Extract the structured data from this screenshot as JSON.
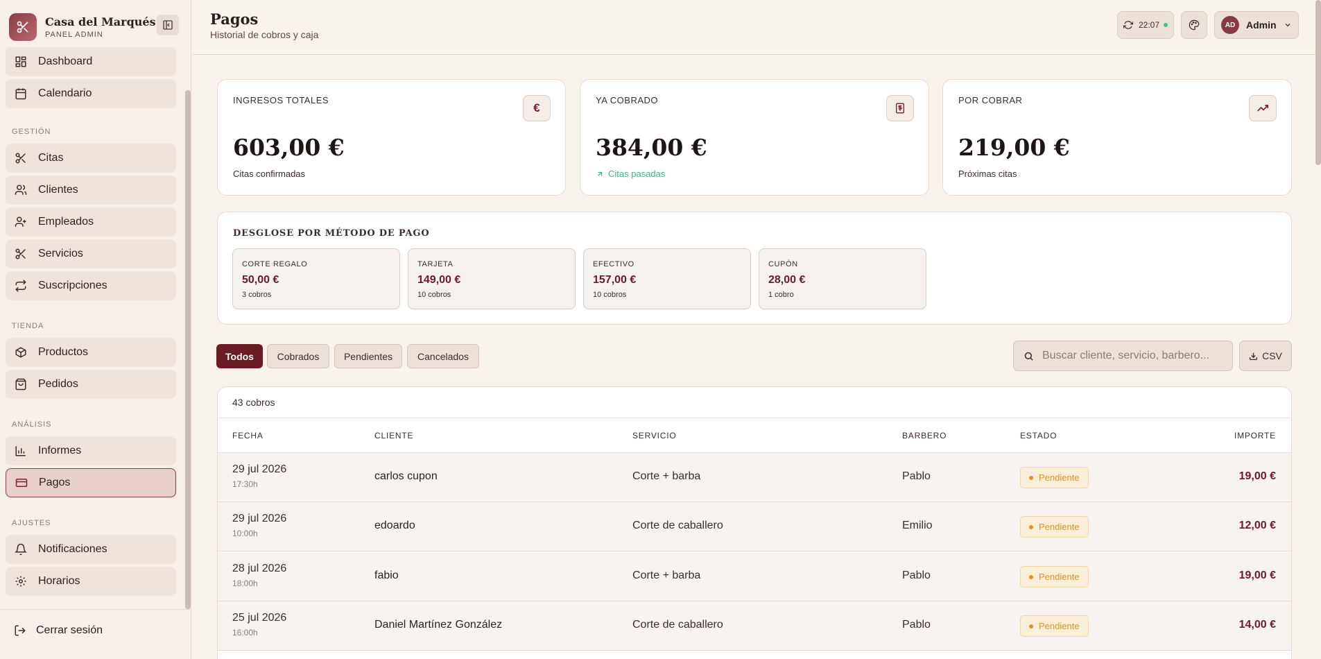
{
  "brand": {
    "name": "Casa del Marqués",
    "subtitle": "PANEL ADMIN"
  },
  "sidebar": {
    "top_items": [
      {
        "label": "Dashboard",
        "icon": "dashboard-icon"
      },
      {
        "label": "Calendario",
        "icon": "calendar-icon"
      }
    ],
    "sections": [
      {
        "label": "GESTIÓN",
        "items": [
          {
            "label": "Citas",
            "icon": "scissors-icon"
          },
          {
            "label": "Clientes",
            "icon": "users-icon"
          },
          {
            "label": "Empleados",
            "icon": "user-plus-icon"
          },
          {
            "label": "Servicios",
            "icon": "scissors-icon"
          },
          {
            "label": "Suscripciones",
            "icon": "repeat-icon"
          }
        ]
      },
      {
        "label": "TIENDA",
        "items": [
          {
            "label": "Productos",
            "icon": "package-icon"
          },
          {
            "label": "Pedidos",
            "icon": "bag-icon"
          }
        ]
      },
      {
        "label": "ANÁLISIS",
        "items": [
          {
            "label": "Informes",
            "icon": "bar-chart-icon"
          },
          {
            "label": "Pagos",
            "icon": "credit-card-icon",
            "active": true
          }
        ]
      },
      {
        "label": "AJUSTES",
        "items": [
          {
            "label": "Notificaciones",
            "icon": "bell-icon"
          },
          {
            "label": "Horarios",
            "icon": "gear-icon"
          }
        ]
      }
    ],
    "logout": "Cerrar sesión"
  },
  "header": {
    "title": "Pagos",
    "subtitle": "Historial de cobros y caja",
    "sync_time": "22:07",
    "user_initials": "AD",
    "user_name": "Admin"
  },
  "stats": [
    {
      "label": "INGRESOS TOTALES",
      "value": "603,00 €",
      "note": "Citas confirmadas",
      "icon": "euro-icon"
    },
    {
      "label": "YA COBRADO",
      "value": "384,00 €",
      "note": "Citas pasadas",
      "icon": "banknote-icon"
    },
    {
      "label": "POR COBRAR",
      "value": "219,00 €",
      "note": "Próximas citas",
      "icon": "trending-up-icon"
    }
  ],
  "breakdown": {
    "title": "DESGLOSE POR MÉTODO DE PAGO",
    "methods": [
      {
        "label": "CORTE REGALO",
        "amount": "50,00 €",
        "count": "3 cobros"
      },
      {
        "label": "TARJETA",
        "amount": "149,00 €",
        "count": "10 cobros"
      },
      {
        "label": "EFECTIVO",
        "amount": "157,00 €",
        "count": "10 cobros"
      },
      {
        "label": "CUPÓN",
        "amount": "28,00 €",
        "count": "1 cobro"
      }
    ]
  },
  "filters": [
    "Todos",
    "Cobrados",
    "Pendientes",
    "Cancelados"
  ],
  "search": {
    "placeholder": "Buscar cliente, servicio, barbero..."
  },
  "csv_label": "CSV",
  "table": {
    "count": "43 cobros",
    "headers": [
      "FECHA",
      "CLIENTE",
      "SERVICIO",
      "BARBERO",
      "ESTADO",
      "IMPORTE"
    ],
    "rows": [
      {
        "date": "29 jul 2026",
        "time": "17:30h",
        "client": "carlos cupon",
        "service": "Corte + barba",
        "barber": "Pablo",
        "status": "Pendiente",
        "amount": "19,00 €"
      },
      {
        "date": "29 jul 2026",
        "time": "10:00h",
        "client": "edoardo",
        "service": "Corte de caballero",
        "barber": "Emilio",
        "status": "Pendiente",
        "amount": "12,00 €"
      },
      {
        "date": "28 jul 2026",
        "time": "18:00h",
        "client": "fabio",
        "service": "Corte + barba",
        "barber": "Pablo",
        "status": "Pendiente",
        "amount": "19,00 €"
      },
      {
        "date": "25 jul 2026",
        "time": "16:00h",
        "client": "Daniel Martínez González",
        "service": "Corte de caballero",
        "barber": "Pablo",
        "status": "Pendiente",
        "amount": "14,00 €"
      }
    ]
  }
}
